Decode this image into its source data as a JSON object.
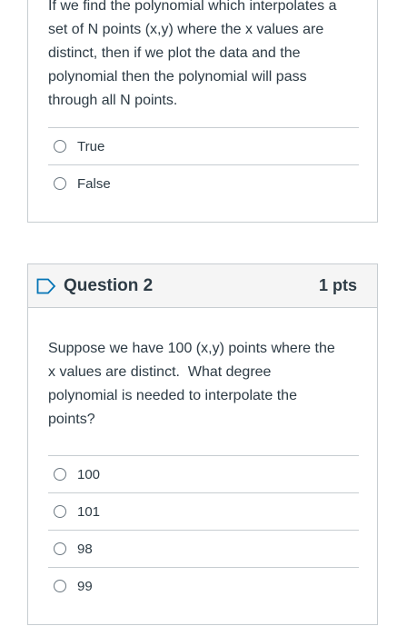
{
  "question1": {
    "text_lines": [
      "If we find the polynomial which interpolates a",
      "set of N points (x,y) where the x values are",
      "distinct, then if we plot the data and the",
      "polynomial then the polynomial will pass",
      "through all N points."
    ],
    "answers": [
      "True",
      "False"
    ]
  },
  "question2": {
    "title": "Question 2",
    "points": "1 pts",
    "text_lines": [
      "Suppose we have 100 (x,y) points where the",
      "x values are distinct.  What degree",
      "polynomial is needed to interpolate the",
      "points?"
    ],
    "answers": [
      "100",
      "101",
      "98",
      "99"
    ]
  },
  "colors": {
    "flag_blue": "#0374b5",
    "border": "#c7cdd1",
    "header_bg": "#f5f5f5",
    "text": "#2d3b45"
  },
  "icons": {
    "flag": "flag-outline-icon",
    "radio": "radio-empty-icon"
  }
}
